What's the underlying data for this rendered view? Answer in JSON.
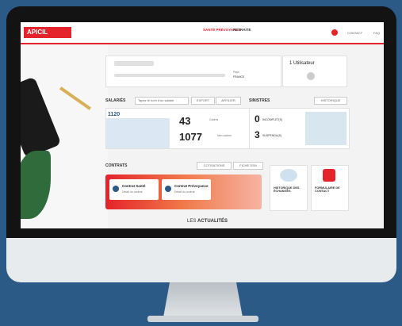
{
  "header": {
    "logo": "APICIL",
    "nav_active": "SANTÉ PRÉVOYANCE",
    "nav_other": "RETRAITE",
    "contact": "CONTACT",
    "faq": "FAQ"
  },
  "company": {
    "location_label": "Pays",
    "location_value": "FRANCE",
    "users": "1 Utilisateur"
  },
  "salaries": {
    "title": "SALARIÉS",
    "search_placeholder": "Tapez le nom d'un salarié",
    "export": "EXPORT",
    "affilier": "AFFILIER",
    "badge": "1120",
    "cadres_count": "43",
    "cadres_label": "Cadres",
    "non_cadres_count": "1077",
    "non_cadres_label": "Non cadres"
  },
  "sinistres": {
    "title": "SINISTRES",
    "historique": "HISTORIQUE",
    "incomplets_count": "0",
    "incomplets_label": "INCOMPLET(S)",
    "suspendus_count": "3",
    "suspendus_label": "SUSPENDU(S)"
  },
  "contrats": {
    "title": "CONTRATS",
    "cotisations": "COTISATIONS",
    "fiche": "FICHE DSN",
    "sante": "Contrat Santé",
    "prevoyance": "Contrat Prévoyance",
    "detail": "Détail du contrat"
  },
  "tiles": {
    "historique": "HISTORIQUE DES ÉCHANGES",
    "formulaire": "FORMULAIRE DE CONTACT"
  },
  "news": {
    "prefix": "LES ",
    "strong": "ACTUALITÉS"
  }
}
